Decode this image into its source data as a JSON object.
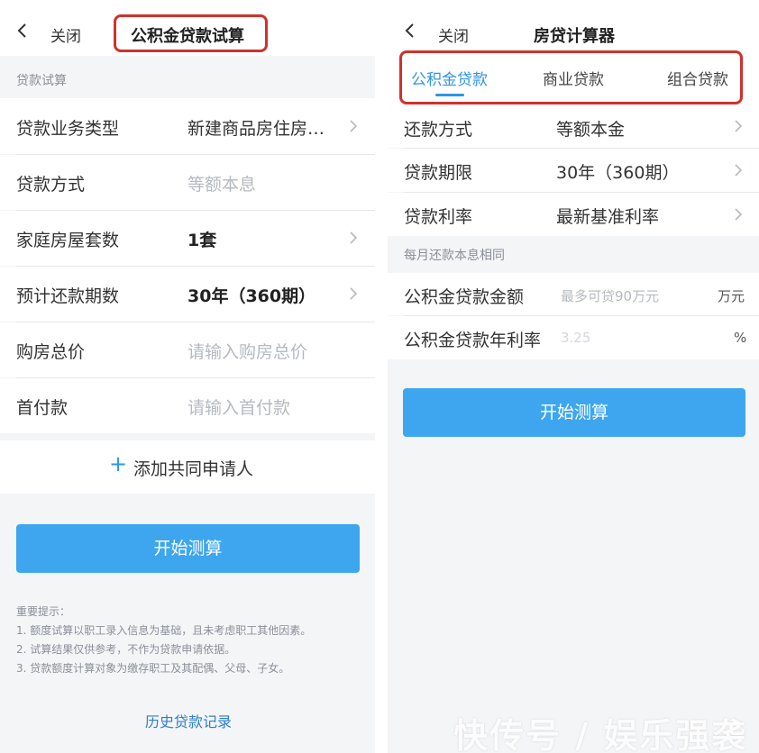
{
  "left": {
    "nav": {
      "close": "关闭",
      "title": "公积金贷款试算"
    },
    "section": "贷款试算",
    "rows": [
      {
        "label": "贷款业务类型",
        "value": "新建商品房住房…"
      },
      {
        "label": "贷款方式",
        "value": "等额本息"
      },
      {
        "label": "家庭房屋套数",
        "value": "1套"
      },
      {
        "label": "预计还款期数",
        "value": "30年（360期）"
      },
      {
        "label": "购房总价",
        "placeholder": "请输入购房总价"
      },
      {
        "label": "首付款",
        "placeholder": "请输入首付款"
      }
    ],
    "add_applicant": "添加共同申请人",
    "start_button": "开始测算",
    "tips": {
      "title": "重要提示：",
      "items": [
        "1. 额度试算以职工录入信息为基础，且未考虑职工其他因素。",
        "2. 试算结果仅供参考，不作为贷款申请依据。",
        "3. 贷款额度计算对象为缴存职工及其配偶、父母、子女。"
      ]
    },
    "history_link": "历史贷款记录"
  },
  "right": {
    "nav": {
      "close": "关闭",
      "title": "房贷计算器"
    },
    "tabs": [
      "公积金贷款",
      "商业贷款",
      "组合贷款"
    ],
    "rows": [
      {
        "label": "还款方式",
        "value": "等额本金"
      },
      {
        "label": "贷款期限",
        "value": "30年（360期）"
      },
      {
        "label": "贷款利率",
        "value": "最新基准利率"
      }
    ],
    "note": "每月还款本息相同",
    "inputs": [
      {
        "label": "公积金贷款金额",
        "placeholder": "最多可贷90万元",
        "unit": "万元"
      },
      {
        "label": "公积金贷款年利率",
        "placeholder": "3.25",
        "unit": "%"
      }
    ],
    "start_button": "开始测算"
  },
  "watermark": "快传号 / 娱乐强袭",
  "colors": {
    "accent": "#3da6ef",
    "tab_active": "#2e95e6",
    "highlight": "#d0312d"
  },
  "icons": {
    "back": "chevron-left-icon",
    "row_arrow": "chevron-right-icon",
    "add": "plus-icon"
  }
}
